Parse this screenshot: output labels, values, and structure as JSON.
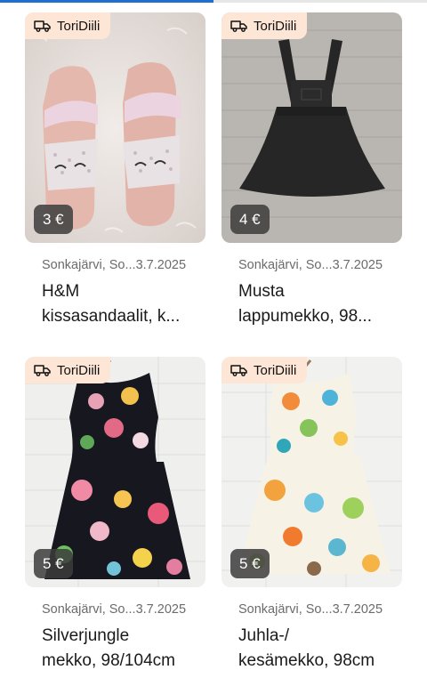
{
  "progress": {
    "fraction": 0.5,
    "color": "#1f6fd1"
  },
  "badge_color": "#fde6d6",
  "listings": [
    {
      "badge": "ToriDiili",
      "price": "3 €",
      "meta": "Sonkajärvi, So...3.7.2025",
      "title_line1": "H&M",
      "title_line2": "kissasandaalit, k...",
      "image": "pink glitter cat sandals on white fur"
    },
    {
      "badge": "ToriDiili",
      "price": "4 €",
      "meta": "Sonkajärvi, So...3.7.2025",
      "title_line1": "Musta",
      "title_line2": "lappumekko, 98...",
      "image": "black pinafore dress on grey carpet"
    },
    {
      "badge": "ToriDiili",
      "price": "5 €",
      "meta": "Sonkajärvi, So...3.7.2025",
      "title_line1": "Silverjungle",
      "title_line2": "mekko, 98/104cm",
      "image": "black floral dress on white wall"
    },
    {
      "badge": "ToriDiili",
      "price": "5 €",
      "meta": "Sonkajärvi, So...3.7.2025",
      "title_line1": "Juhla-/",
      "title_line2": "kesämekko, 98cm",
      "image": "light floral summer dress on white wall"
    }
  ]
}
